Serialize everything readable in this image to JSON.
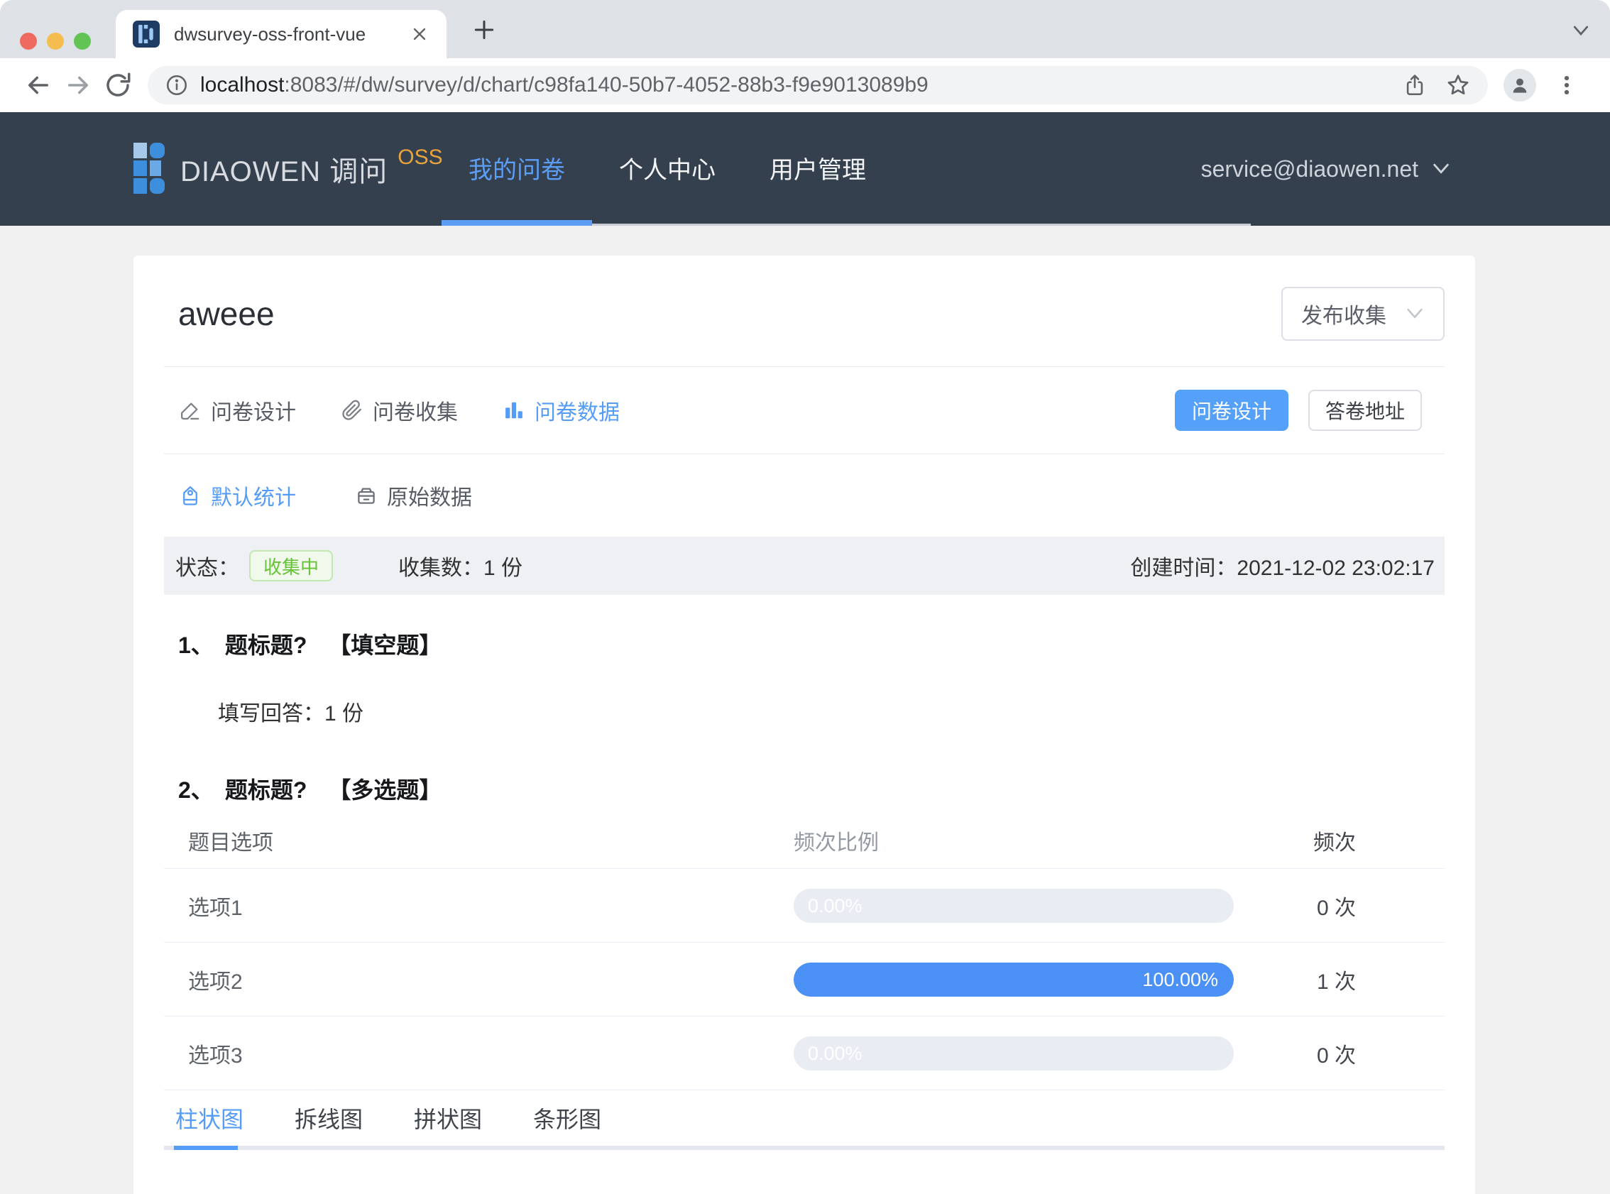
{
  "browser": {
    "tab_title": "dwsurvey-oss-front-vue",
    "url_host": "localhost",
    "url_path": ":8083/#/dw/survey/d/chart/c98fa140-50b7-4052-88b3-f9e9013089b9"
  },
  "header": {
    "brand": "DIAOWEN 调问",
    "brand_badge": "OSS",
    "nav": {
      "item1": "我的问卷",
      "item2": "个人中心",
      "item3": "用户管理"
    },
    "account_email": "service@diaowen.net"
  },
  "survey": {
    "title": "aweee",
    "publish_select": "发布收集",
    "tab_design": "问卷设计",
    "tab_collect": "问卷收集",
    "tab_data": "问卷数据",
    "btn_design": "问卷设计",
    "btn_answer_url": "答卷地址",
    "subtab_default": "默认统计",
    "subtab_raw": "原始数据",
    "status_label": "状态：",
    "status_badge": "收集中",
    "count_label": "收集数：",
    "count_value": "1 份",
    "created_label": "创建时间：",
    "created_value": "2021-12-02 23:02:17"
  },
  "q1": {
    "num": "1、",
    "title": "题标题?",
    "type": "【填空题】",
    "answer_label": "填写回答：",
    "answer_value": "1 份"
  },
  "q2": {
    "num": "2、",
    "title": "题标题?",
    "type": "【多选题】",
    "col_option": "题目选项",
    "col_ratio": "频次比例",
    "col_freq": "频次",
    "rows": [
      {
        "option": "选项1",
        "percent": "0.00%",
        "value": 0,
        "count": "0 次"
      },
      {
        "option": "选项2",
        "percent": "100.00%",
        "value": 100,
        "count": "1 次"
      },
      {
        "option": "选项3",
        "percent": "0.00%",
        "value": 0,
        "count": "0 次"
      }
    ]
  },
  "chart_tabs": {
    "bar": "柱状图",
    "line": "拆线图",
    "pie": "拼状图",
    "hbar": "条形图"
  },
  "colors": {
    "accent": "#549CF8",
    "bar_fill": "#4A90F5",
    "bar_track": "#E9ECF2",
    "header_bg": "#35404F",
    "badge_green": "#67C23A",
    "badge_bg": "#F0F9EB",
    "brand_orange": "#E8A33D",
    "status_band_bg": "#EEF0F4"
  }
}
